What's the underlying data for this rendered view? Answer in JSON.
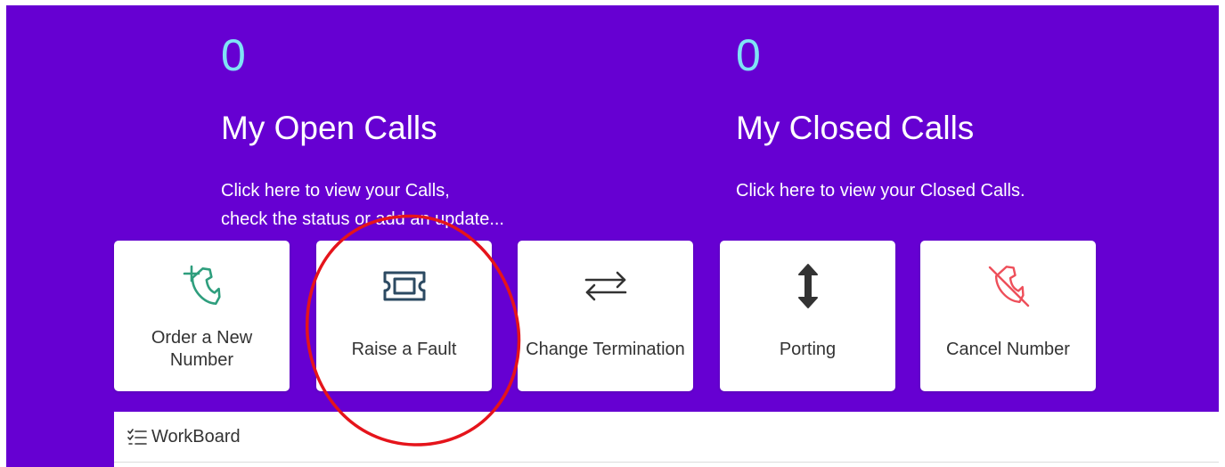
{
  "stats": {
    "open": {
      "count": "0",
      "title": "My Open Calls",
      "line1": "Click here to view your Calls,",
      "line2": "check the status or add an update..."
    },
    "closed": {
      "count": "0",
      "title": "My Closed Calls",
      "line1": "Click here to view your Closed Calls."
    }
  },
  "tiles": [
    {
      "label": "Order a New Number",
      "icon": "phone-add-icon",
      "color": "#2e9e7d"
    },
    {
      "label": "Raise a Fault",
      "icon": "ticket-icon",
      "color": "#2c4a62"
    },
    {
      "label": "Change Termination",
      "icon": "arrows-exchange-icon",
      "color": "#333333"
    },
    {
      "label": "Porting",
      "icon": "arrows-vertical-icon",
      "color": "#333333"
    },
    {
      "label": "Cancel Number",
      "icon": "phone-off-icon",
      "color": "#ee4f5a"
    }
  ],
  "workboard": {
    "title": "WorkBoard",
    "icon": "checklist-icon"
  },
  "colors": {
    "background": "#6600d2",
    "count": "#7fe3f5",
    "annotation": "#e5141b"
  }
}
